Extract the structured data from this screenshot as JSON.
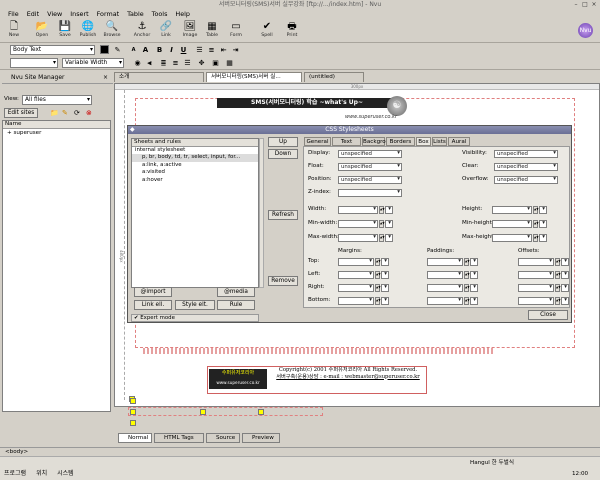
{
  "window": {
    "title": "서버모니터링(SMS)서버 실무강좌 [ftp://.../index.htm] - Nvu"
  },
  "menu": [
    "File",
    "Edit",
    "View",
    "Insert",
    "Format",
    "Table",
    "Tools",
    "Help"
  ],
  "toolbar": [
    {
      "label": "New",
      "icon": "new-file-icon",
      "glyph": "🗋"
    },
    {
      "label": "Open",
      "icon": "open-folder-icon",
      "glyph": "📂"
    },
    {
      "label": "Save",
      "icon": "save-icon",
      "glyph": "💾"
    },
    {
      "label": "Publish",
      "icon": "publish-icon",
      "glyph": "🌐"
    },
    {
      "label": "Browse",
      "icon": "browse-icon",
      "glyph": "🔍"
    },
    {
      "label": "Anchor",
      "icon": "anchor-icon",
      "glyph": "⚓"
    },
    {
      "label": "Link",
      "icon": "link-icon",
      "glyph": "🔗"
    },
    {
      "label": "Image",
      "icon": "image-icon",
      "glyph": "🖼"
    },
    {
      "label": "Table",
      "icon": "table-icon",
      "glyph": "▦"
    },
    {
      "label": "Form",
      "icon": "form-icon",
      "glyph": "▭"
    },
    {
      "label": "Spell",
      "icon": "spell-icon",
      "glyph": "✔"
    },
    {
      "label": "Print",
      "icon": "print-icon",
      "glyph": "🖶"
    }
  ],
  "format": {
    "paragraph": "Body Text",
    "font": "Variable Width",
    "size": ""
  },
  "sitemgr": {
    "title": "Nvu Site Manager",
    "view_label": "View:",
    "view_value": "All files",
    "edit_sites": "Edit sites",
    "tree_header": "Name",
    "tree_item": "superuser"
  },
  "tabs": [
    "소개",
    "서버모니터링(SMS)서버 실...",
    "(untitled)"
  ],
  "editor": {
    "banner": "SMS(서버모니터링) 학습 ~what's Up~",
    "site_url": "www.superuser.co.kr",
    "copyright": "Copyright(c) 2001 수퍼유저코리아 All Rights Reserved.",
    "contact": "서버구축(운용)상담 : e-mail : webmaster@superuser.co.kr",
    "logo_text": "수퍼유저코리아",
    "logo_url": "www.superuser.co.kr",
    "width_marker": "300px",
    "side_marker": "480px"
  },
  "dialog": {
    "title": "CSS Stylesheets",
    "tree_header": "Sheets and rules",
    "rules": [
      "internal stylesheet",
      "p, br, body, td, tr, select, input, for...",
      "a:link, a:active",
      "a:visited",
      "a:hover"
    ],
    "side_buttons": [
      "Up",
      "Down",
      "Refresh",
      "Remove"
    ],
    "bottom_buttons": [
      "@import",
      "@media",
      "Link ell.",
      "Style elt.",
      "Rule"
    ],
    "expert": "Expert mode",
    "panel_tabs": [
      "General",
      "Text",
      "Background",
      "Borders",
      "Box",
      "Lists",
      "Aural"
    ],
    "left_props": [
      {
        "label": "Display:",
        "value": "unspecified"
      },
      {
        "label": "Float:",
        "value": "unspecified"
      },
      {
        "label": "Position:",
        "value": "unspecified"
      },
      {
        "label": "Z-index:",
        "value": ""
      }
    ],
    "right_props": [
      {
        "label": "Visibility:",
        "value": "unspecified"
      },
      {
        "label": "Clear:",
        "value": "unspecified"
      },
      {
        "label": "Overflow:",
        "value": "unspecified"
      }
    ],
    "size_left": [
      "Width:",
      "Min-width:",
      "Max-width:"
    ],
    "size_right": [
      "Height:",
      "Min-height:",
      "Max-height:"
    ],
    "group_headers": [
      "Margins:",
      "Paddings:",
      "Offsets:"
    ],
    "sides": [
      "Top:",
      "Left:",
      "Right:",
      "Bottom:"
    ],
    "close": "Close"
  },
  "viewtabs": [
    "Normal",
    "HTML Tags",
    "Source",
    "Preview"
  ],
  "status": "<body>",
  "taskbar": {
    "items": [
      "프로그램",
      "위치",
      "시스템"
    ],
    "tray": "Hangul 한 두벌식",
    "clock": "12:00"
  }
}
